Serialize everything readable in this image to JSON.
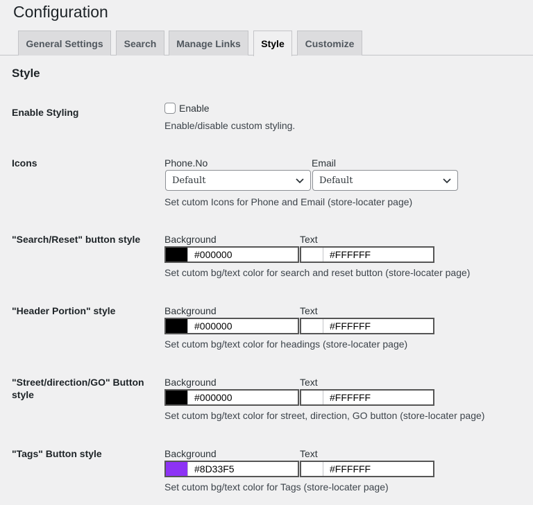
{
  "header": {
    "title": "Configuration"
  },
  "tabs": [
    {
      "label": "General Settings"
    },
    {
      "label": "Search"
    },
    {
      "label": "Manage Links"
    },
    {
      "label": "Style"
    },
    {
      "label": "Customize"
    }
  ],
  "active_tab": "Style",
  "section_title": "Style",
  "enable_styling": {
    "label": "Enable Styling",
    "checkbox_label": "Enable",
    "checked": false,
    "description": "Enable/disable custom styling."
  },
  "icons": {
    "label": "Icons",
    "phone_label": "Phone.No",
    "phone_value": "Default",
    "email_label": "Email",
    "email_value": "Default",
    "description": "Set cutom Icons for Phone and Email (store-locater page)"
  },
  "color_rows": [
    {
      "label": "\"Search/Reset\" button style",
      "bg_label": "Background",
      "bg_value": "#000000",
      "bg_color": "#000000",
      "text_label": "Text",
      "text_value": "#FFFFFF",
      "text_color": "#FFFFFF",
      "description": "Set cutom bg/text color for search and reset button (store-locater page)"
    },
    {
      "label": "\"Header Portion\" style",
      "bg_label": "Background",
      "bg_value": "#000000",
      "bg_color": "#000000",
      "text_label": "Text",
      "text_value": "#FFFFFF",
      "text_color": "#FFFFFF",
      "description": "Set cutom bg/text color for headings (store-locater page)"
    },
    {
      "label": "\"Street/direction/GO\" Button style",
      "bg_label": "Background",
      "bg_value": "#000000",
      "bg_color": "#000000",
      "text_label": "Text",
      "text_value": "#FFFFFF",
      "text_color": "#FFFFFF",
      "description": "Set cutom bg/text color for street, direction, GO button (store-locater page)"
    },
    {
      "label": "\"Tags\" Button style",
      "bg_label": "Background",
      "bg_value": "#8D33F5",
      "bg_color": "#8D33F5",
      "text_label": "Text",
      "text_value": "#FFFFFF",
      "text_color": "#FFFFFF",
      "description": "Set cutom bg/text color for Tags (store-locater page)"
    }
  ]
}
